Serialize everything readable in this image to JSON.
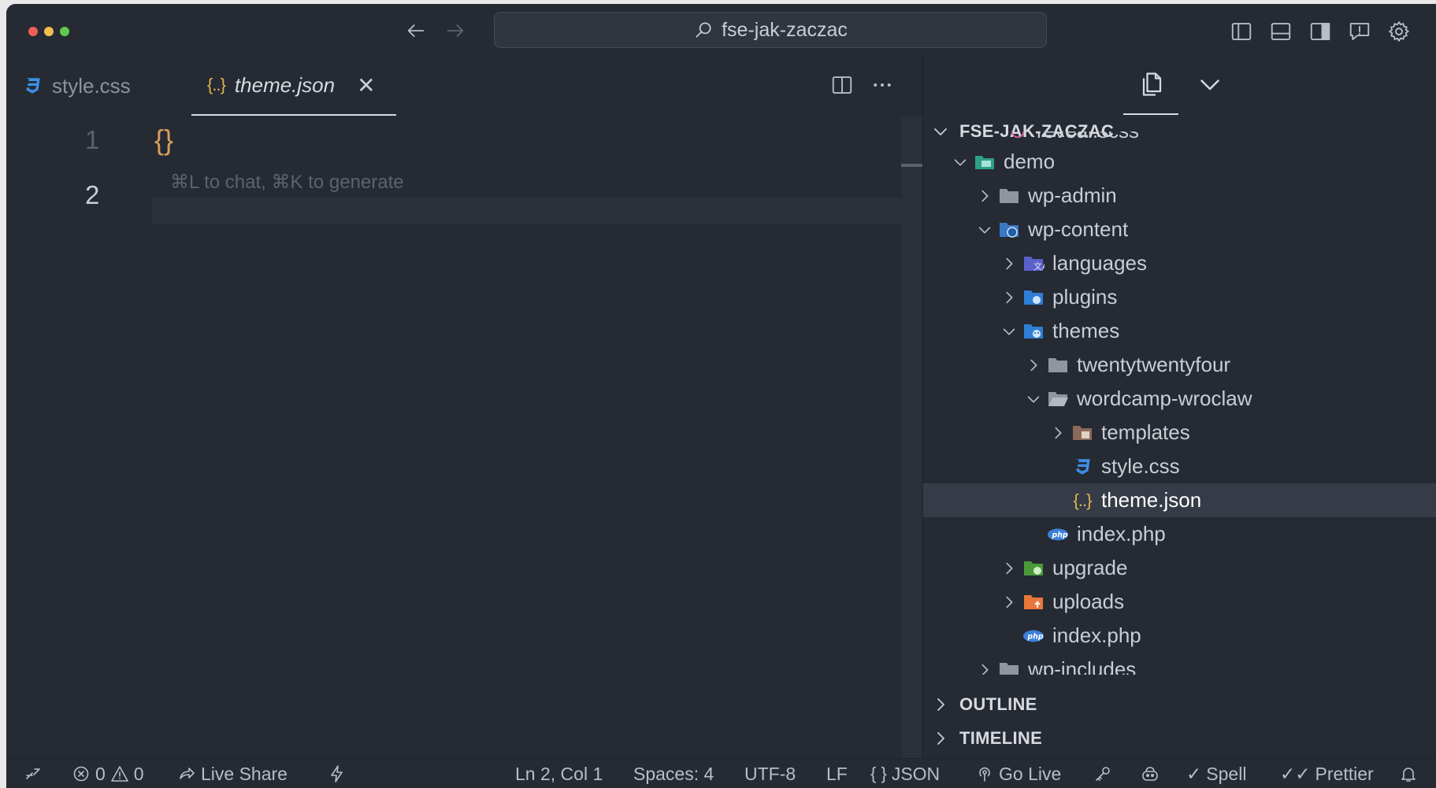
{
  "titlebar": {
    "search_text": "fse-jak-zaczac"
  },
  "editor": {
    "tabs": [
      {
        "label": "style.css",
        "icon": "css-icon",
        "active": false
      },
      {
        "label": "theme.json",
        "icon": "json-icon",
        "active": true
      }
    ],
    "line_numbers": [
      "1",
      "2"
    ],
    "code_line_1": "{}",
    "hint": "⌘L to chat, ⌘K to generate"
  },
  "explorer": {
    "root_label": "FSE-JAK-ZACZAC",
    "tree": [
      {
        "label": "reveal.scss",
        "partial": true
      },
      {
        "label": "demo",
        "type": "folder-open"
      },
      {
        "label": "wp-admin",
        "type": "folder"
      },
      {
        "label": "wp-content",
        "type": "folder-open"
      },
      {
        "label": "languages",
        "type": "folder"
      },
      {
        "label": "plugins",
        "type": "folder"
      },
      {
        "label": "themes",
        "type": "folder-open"
      },
      {
        "label": "twentytwentyfour",
        "type": "folder"
      },
      {
        "label": "wordcamp-wroclaw",
        "type": "folder-open"
      },
      {
        "label": "templates",
        "type": "folder"
      },
      {
        "label": "style.css",
        "type": "file"
      },
      {
        "label": "theme.json",
        "type": "file",
        "selected": true
      },
      {
        "label": "index.php",
        "type": "file"
      },
      {
        "label": "upgrade",
        "type": "folder"
      },
      {
        "label": "uploads",
        "type": "folder"
      },
      {
        "label": "index.php",
        "type": "file"
      },
      {
        "label": "wp-includes",
        "type": "folder",
        "partial": true
      }
    ],
    "outline_label": "OUTLINE",
    "timeline_label": "TIMELINE"
  },
  "statusbar": {
    "errors": "0",
    "warnings": "0",
    "live_share": "Live Share",
    "cursor": "Ln 2, Col 1",
    "spaces": "Spaces: 4",
    "encoding": "UTF-8",
    "eol": "LF",
    "language": "JSON",
    "go_live": "Go Live",
    "spell": "Spell",
    "prettier": "Prettier"
  },
  "colors": {
    "background": "#252a33",
    "accent_json": "#e1b54b",
    "accent_css": "#3d8fe8",
    "brace": "#d69e5b"
  }
}
